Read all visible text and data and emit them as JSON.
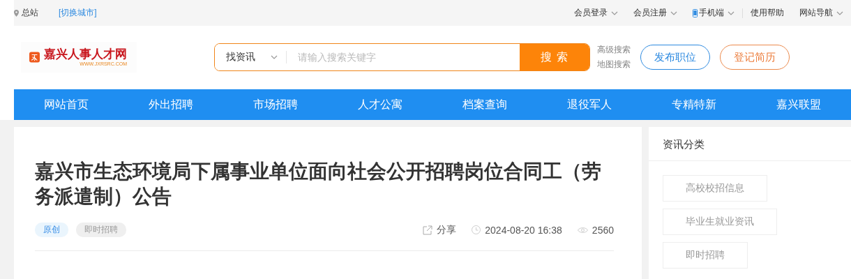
{
  "top_bar": {
    "location": "总站",
    "switch_city": "[切换城市]",
    "links": [
      {
        "label": "会员登录",
        "kind": "dropdown"
      },
      {
        "label": "会员注册",
        "kind": "dropdown"
      },
      {
        "label": "手机端",
        "kind": "mobile"
      },
      {
        "label": "使用帮助",
        "kind": "plain"
      },
      {
        "label": "网站导航",
        "kind": "dropdown"
      }
    ]
  },
  "header": {
    "logo": {
      "name": "嘉兴人事人才网",
      "url": "WWW.JXRSRC.COM"
    },
    "search": {
      "category": "找资讯",
      "placeholder": "请输入搜索关键字",
      "button": "搜 索"
    },
    "search_links": [
      "高级搜索",
      "地图搜索"
    ],
    "buttons": [
      {
        "label": "发布职位",
        "kind": "post"
      },
      {
        "label": "登记简历",
        "kind": "resume"
      }
    ]
  },
  "nav": [
    {
      "label": "网站首页",
      "selected": false
    },
    {
      "label": "外出招聘",
      "selected": false
    },
    {
      "label": "市场招聘",
      "selected": false
    },
    {
      "label": "人才公寓",
      "selected": false
    },
    {
      "label": "档案查询",
      "selected": false
    },
    {
      "label": "退役军人",
      "selected": false
    },
    {
      "label": "专精特新",
      "selected": false
    },
    {
      "label": "嘉兴联盟",
      "selected": false
    }
  ],
  "article": {
    "title": "嘉兴市生态环境局下属事业单位面向社会公开招聘岗位合同工（劳务派遣制）公告",
    "tags": [
      {
        "label": "原创",
        "kind": "original"
      },
      {
        "label": "即时招聘",
        "kind": "category"
      }
    ],
    "share": "分享",
    "date": "2024-08-20 16:38",
    "views": "2560"
  },
  "sidebar": {
    "title": "资讯分类",
    "items": [
      "高校校招信息",
      "毕业生就业资讯",
      "即时招聘"
    ]
  }
}
